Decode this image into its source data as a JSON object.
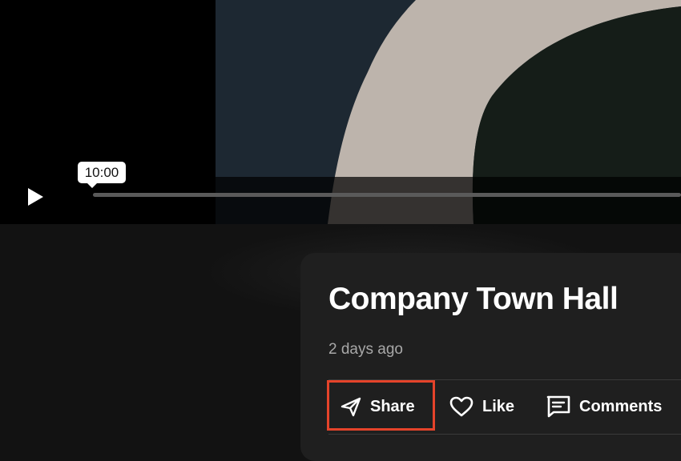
{
  "player": {
    "hover_time": "10:00",
    "progress_fraction": 0.0,
    "icons": {
      "play": "play-icon"
    }
  },
  "video": {
    "title": "Company Town Hall",
    "posted": "2 days ago"
  },
  "actions": {
    "share_label": "Share",
    "like_label": "Like",
    "comments_label": "Comments",
    "highlight_color": "#e5432a",
    "icons": {
      "share": "send-icon",
      "like": "heart-icon",
      "comments": "comment-icon"
    }
  },
  "colors": {
    "background": "#121212",
    "card": "#1f1f1f",
    "muted_text": "#a8a8a8"
  }
}
